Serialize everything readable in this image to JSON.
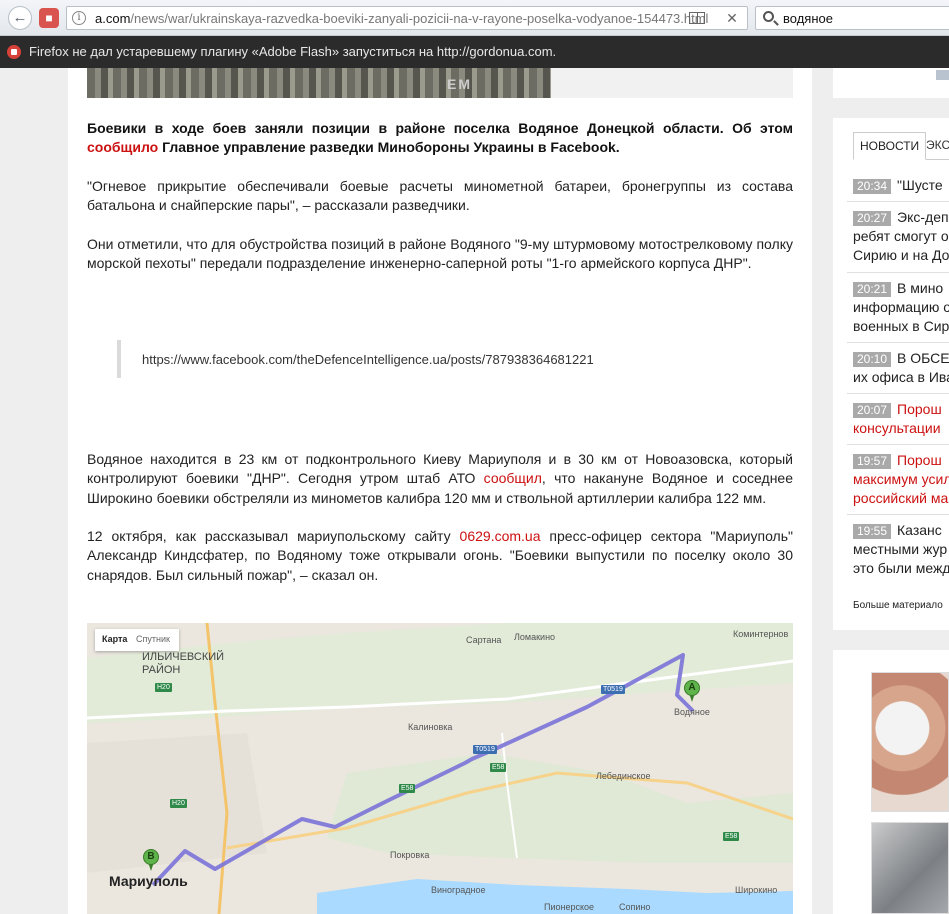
{
  "browser": {
    "back_icon": "back-arrow-icon",
    "url_host": "a.com",
    "url_path": "/news/war/ukrainskaya-razvedka-boeviki-zanyali-pozicii-na-v-rayone-poselka-vodyanoe-154473.html",
    "search_value": "водяное",
    "notification": "Firefox не дал устаревшему плагину «Adobe Flash» запуститься на http://gordonua.com."
  },
  "article": {
    "photo_text": "EM",
    "lead_text": "Боевики в ходе боев заняли позиции в районе поселка Водяное Донецкой области. Об этом ",
    "lead_link": "сообщило",
    "lead_end": " Главное управление разведки Минобороны Украины в Facebook.",
    "p1": "\"Огневое прикрытие обеспечивали боевые расчеты минометной батареи, бронегруппы из состава батальона и снайперские пары\", – рассказали разведчики.",
    "p2": "Они отметили, что для обустройства позиций в районе Водяного \"9-му штурмовому мотострелковому полку морской пехоты\" передали подразделение инженерно-саперной роты \"1-го армейского корпуса ДНР\".",
    "quote_link": "https://www.facebook.com/theDefenceIntelligence.ua/posts/787938364681221",
    "p3_a": "Водяное находится в 23 км от подконтрольного Киеву Мариуполя и в 30 км от Новоазовска, который контролируют боевики \"ДНР\". Сегодня утром штаб АТО ",
    "p3_link": "сообщил",
    "p3_b": ", что накануне Водяное и соседнее Широкино боевики обстреляли из минометов калибра 120 мм и ствольной артиллерии калибра 122 мм.",
    "p4_a": "12 октября, как рассказывал мариупольскому сайту ",
    "p4_link": "0629.com.ua",
    "p4_b": " пресс-офицер сектора \"Мариуполь\" Александр Киндсфатер, по Водяному тоже открывали огонь. \"Боевики выпустили по поселку около 30 снарядов. Был сильный пожар\", – сказал он."
  },
  "map": {
    "type_map": "Карта",
    "type_satellite": "Спутник",
    "labels": {
      "district": "ИЛЬИЧЕВСКИЙ\nРАЙОН",
      "sartana": "Сартана",
      "lomakino": "Ломакино",
      "kominternovo": "Коминтернов",
      "kalinovka": "Калиновка",
      "vodyanoe": "Водяное",
      "lebedinskoe": "Лебединское",
      "mariupol": "Мариуполь",
      "vinogradnoe": "Виноградное",
      "shirokino": "Широкино",
      "pionerskoe": "Пионерское",
      "sopino": "Сопино",
      "pokrovka": "Покровка"
    },
    "roads": [
      "H20",
      "H20",
      "T0519",
      "T0519",
      "E58",
      "E58",
      "E58"
    ],
    "pin_a": "A",
    "pin_b": "B"
  },
  "sidebar": {
    "tab_news": "НОВОСТИ",
    "tab_other": "ЭКС",
    "news": [
      {
        "time": "20:34",
        "text": "\"Шусте",
        "hot": false
      },
      {
        "time": "20:27",
        "text": "Экс-деп",
        "line2": "ребят смогут о",
        "line3": "Сирию и на До",
        "hot": false
      },
      {
        "time": "20:21",
        "text": "В мино",
        "line2": "информацию о",
        "line3": "военных в Сир",
        "hot": false
      },
      {
        "time": "20:10",
        "text": "В ОБСЕ",
        "line2": "их офиса в Ива",
        "hot": false
      },
      {
        "time": "20:07",
        "text": "Порош",
        "line2": "консультации",
        "hot": true
      },
      {
        "time": "19:57",
        "text": "Порош",
        "line2": "максимум усил",
        "line3": "российский ма",
        "hot": true
      },
      {
        "time": "19:55",
        "text": "Казанс",
        "line2": "местными жур",
        "line3": "это были межд",
        "hot": false
      }
    ],
    "more": "Больше материало"
  }
}
